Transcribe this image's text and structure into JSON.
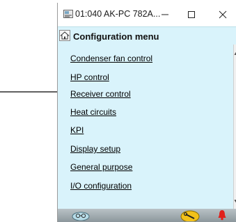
{
  "window": {
    "title": "01:040 AK-PC 782A...",
    "icons": {
      "app": "device-icon",
      "minimize": "minimize-icon",
      "maximize": "maximize-icon",
      "close": "close-icon"
    }
  },
  "menu": {
    "title": "Configuration menu",
    "home_icon": "home-icon",
    "items": [
      {
        "label": "Condenser fan control"
      },
      {
        "label": "HP control"
      },
      {
        "label": "Receiver control"
      },
      {
        "label": "Heat circuits"
      },
      {
        "label": "KPI"
      },
      {
        "label": "Display setup"
      },
      {
        "label": "General purpose"
      },
      {
        "label": "I/O configuration"
      }
    ]
  },
  "footer": {
    "icons": [
      "glasses-icon",
      "tool-icon",
      "alarm-bell-icon"
    ]
  },
  "colors": {
    "menu_background": "#d9f3fb",
    "footer_background": "#9aa5aa",
    "alarm": "#e0201b",
    "tool": "#f2c11a"
  }
}
